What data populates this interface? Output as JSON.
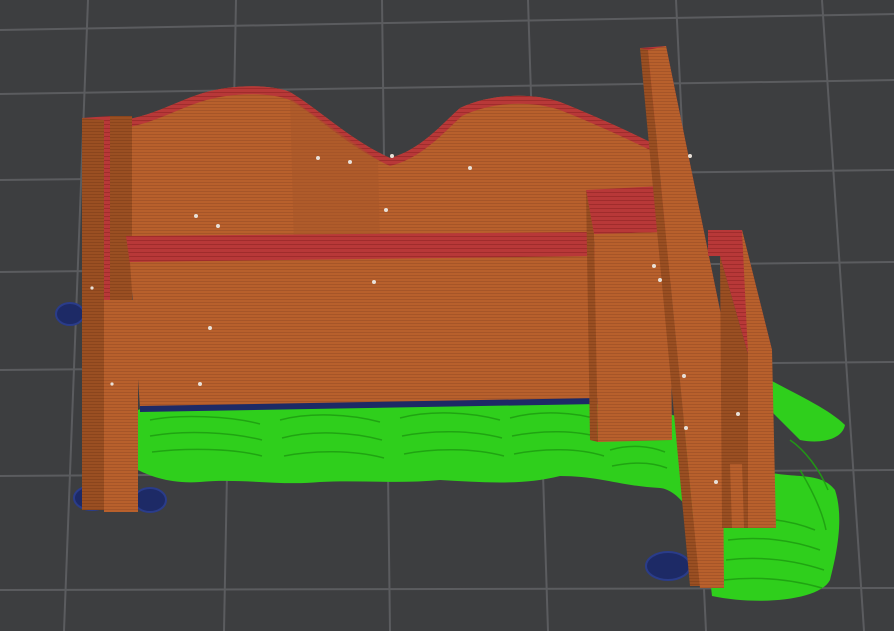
{
  "viewer": {
    "colors": {
      "background": "#3d3e40",
      "grid_line": "#5b5c5f",
      "wall": "#b8602c",
      "wall_dark": "#9a4f22",
      "wall_shade": "#c9703a",
      "top_edge": "#b83838",
      "support": "#33d41e",
      "support_dark": "#1fa012",
      "brim": "#1d2a66",
      "brim_mark": "#2a3c8a",
      "seam_dot": "#e8e0d8"
    },
    "objects": {
      "model": "sliced-model",
      "supports": "tree-supports",
      "mouse_ears": "brim-mouse-ears"
    }
  }
}
